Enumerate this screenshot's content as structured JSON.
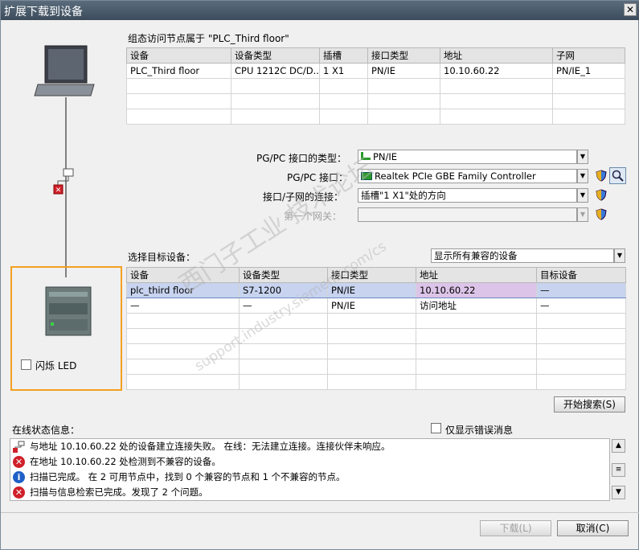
{
  "window": {
    "title": "扩展下载到设备",
    "close": "✕"
  },
  "config": {
    "heading": "组态访问节点属于 \"PLC_Third floor\"",
    "columns": [
      "设备",
      "设备类型",
      "插槽",
      "接口类型",
      "地址",
      "子网"
    ],
    "rows": [
      [
        "PLC_Third floor",
        "CPU 1212C DC/D...",
        "1 X1",
        "PN/IE",
        "10.10.60.22",
        "PN/IE_1"
      ]
    ]
  },
  "interface": {
    "type_label": "PG/PC 接口的类型：",
    "type_value": "PN/IE",
    "pgpc_label": "PG/PC 接口：",
    "pgpc_value": "Realtek PCIe GBE Family Controller",
    "conn_label": "接口/子网的连接：",
    "conn_value": "插槽\"1 X1\"处的方向",
    "gateway_label": "第一个网关：",
    "gateway_value": ""
  },
  "target": {
    "label": "选择目标设备：",
    "filter_value": "显示所有兼容的设备",
    "columns": [
      "设备",
      "设备类型",
      "接口类型",
      "地址",
      "目标设备"
    ],
    "rows": [
      [
        "plc_third floor",
        "S7-1200",
        "PN/IE",
        "10.10.60.22",
        "—"
      ],
      [
        "—",
        "—",
        "PN/IE",
        "访问地址",
        "—"
      ]
    ]
  },
  "flash_led": "闪烁 LED",
  "search_button": "开始搜索(S)",
  "status": {
    "label": "在线状态信息：",
    "errors_only": "仅显示错误消息",
    "messages": [
      {
        "icon": "connection-error-icon",
        "text": "与地址 10.10.60.22 处的设备建立连接失败。 在线：无法建立连接。连接伙伴未响应。"
      },
      {
        "icon": "error-icon",
        "text": "在地址 10.10.60.22 处检测到不兼容的设备。"
      },
      {
        "icon": "info-icon",
        "text": "扫描已完成。 在 2 可用节点中，找到 0 个兼容的节点和 1 个不兼容的节点。"
      },
      {
        "icon": "error-icon",
        "text": "扫描与信息检索已完成。发现了 2 个问题。"
      }
    ]
  },
  "buttons": {
    "download": "下载(L)",
    "cancel": "取消(C)"
  },
  "watermark": {
    "line1": "西门子工业  技术论坛",
    "line2": "support.industry.siemens.com/cs"
  },
  "colors": {
    "selected_row": "#c7d3ef",
    "address_highlight": "#dcc4e8",
    "focus_border": "#f4a020",
    "error": "#d0202a",
    "info": "#1e5fc7"
  }
}
